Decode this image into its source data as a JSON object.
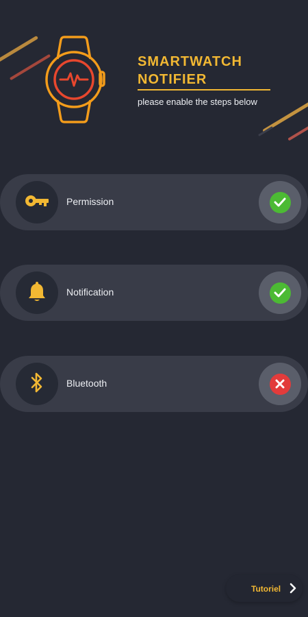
{
  "header": {
    "title_line1": "SMARTWATCH",
    "title_line2": "NOTIFIER",
    "subtitle": "please enable the steps below"
  },
  "steps": [
    {
      "label": "Permission",
      "icon": "key-icon",
      "status": "enabled"
    },
    {
      "label": "Notification",
      "icon": "bell-icon",
      "status": "enabled"
    },
    {
      "label": "Bluetooth",
      "icon": "bluetooth-icon",
      "status": "disabled"
    }
  ],
  "footer": {
    "tutorial_label": "Tutoriel"
  },
  "colors": {
    "background": "#252833",
    "accent": "#f2b833",
    "watch_strap": "#f39c1b",
    "heart_ring": "#e8472e",
    "success": "#4cba34",
    "error": "#e23b3b"
  }
}
